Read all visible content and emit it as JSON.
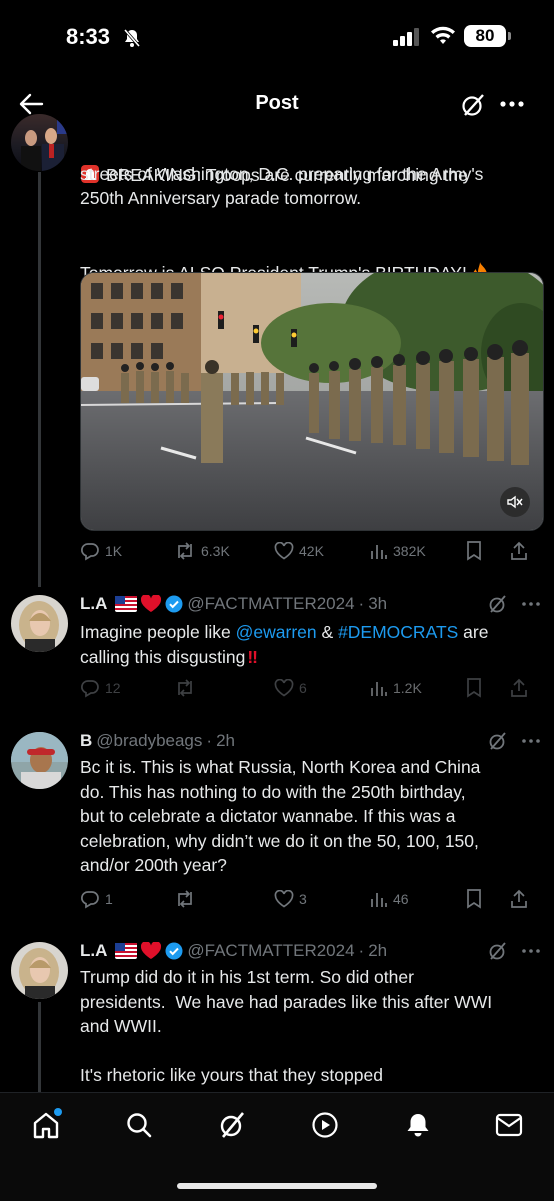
{
  "status_bar": {
    "time": "8:33",
    "battery": "80"
  },
  "header": {
    "title": "Post"
  },
  "main_post": {
    "text_line1": "BREAKING: Troops are currently marching the",
    "text_line2": "streets of Washington, D.C. preparing for the Army's",
    "text_line3": "250th Anniversary parade tomorrow.",
    "text_line4": "Tomorrow is ALSO President Trump's BIRTHDAY!",
    "stats": {
      "replies": "1K",
      "reposts": "6.3K",
      "likes": "42K",
      "views": "382K"
    }
  },
  "replies": [
    {
      "name": "L.A",
      "handle": "@FACTMATTER2024",
      "time": "3h",
      "text_prefix": "Imagine people like ",
      "mention": "@ewarren",
      "text_mid": " & ",
      "hashtag": "#DEMOCRATS",
      "text_suffix": " are",
      "text_line2": "calling this disgusting",
      "stats": {
        "replies": "12",
        "reposts": "",
        "likes": "6",
        "views": "1.2K"
      }
    },
    {
      "name": "B",
      "handle": "@bradybeags",
      "time": "2h",
      "text": "Bc it is. This is what Russia, North Korea and China\ndo. This has nothing to do with the 250th birthday,\nbut to celebrate a dictator wannabe. If this was a\ncelebration, why didn’t we do it on the 50, 100, 150,\nand/or 200th year?",
      "stats": {
        "replies": "1",
        "reposts": "",
        "likes": "3",
        "views": "46"
      }
    },
    {
      "name": "L.A",
      "handle": "@FACTMATTER2024",
      "time": "2h",
      "text": "Trump did do it in his 1st term. So did other\npresidents.  We have had parades like this after WWI\nand WWII.\n\nIt's rhetoric like yours that they stopped"
    }
  ],
  "icons": {
    "back": "back-arrow-icon",
    "grok": "grok-icon",
    "more": "more-icon",
    "siren": "siren-emoji",
    "fire": "fire-emoji",
    "mute": "mute-icon",
    "verified": "verified-badge-icon"
  },
  "colors": {
    "accent": "#1d9bf0",
    "muted": "#71767b",
    "background": "#000000",
    "like_heart": "#e0245e"
  }
}
